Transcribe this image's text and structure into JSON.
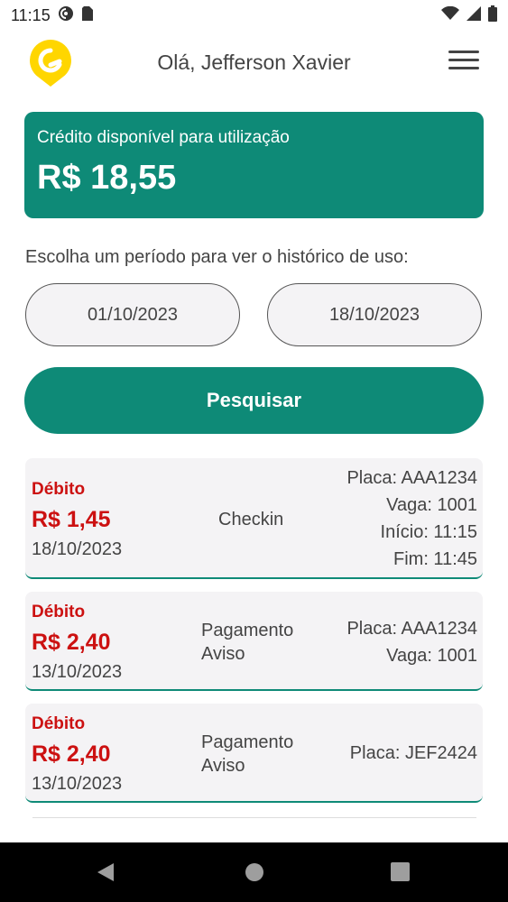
{
  "status": {
    "time": "11:15"
  },
  "header": {
    "greeting": "Olá, Jefferson Xavier"
  },
  "credit": {
    "label": "Crédito disponível para utilização",
    "value": "R$ 18,55"
  },
  "period": {
    "label": "Escolha um período para ver o histórico de uso:",
    "start": "01/10/2023",
    "end": "18/10/2023"
  },
  "search": {
    "label": "Pesquisar"
  },
  "history": [
    {
      "type": "Débito",
      "amount": "R$ 1,45",
      "date": "18/10/2023",
      "desc1": "Checkin",
      "desc2": "",
      "d1": "Placa: AAA1234",
      "d2": "Vaga: 1001",
      "d3": "Início: 11:15",
      "d4": "Fim: 11:45"
    },
    {
      "type": "Débito",
      "amount": "R$ 2,40",
      "date": "13/10/2023",
      "desc1": "Pagamento",
      "desc2": "Aviso",
      "d1": "Placa: AAA1234",
      "d2": "Vaga: 1001"
    },
    {
      "type": "Débito",
      "amount": "R$ 2,40",
      "date": "13/10/2023",
      "desc1": "Pagamento",
      "desc2": "Aviso",
      "d1": "Placa: JEF2424"
    }
  ],
  "colors": {
    "accent": "#0e8a77",
    "debit": "#cc1111"
  }
}
